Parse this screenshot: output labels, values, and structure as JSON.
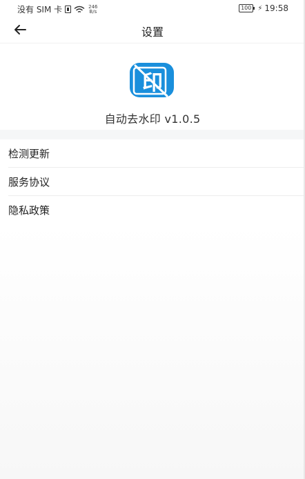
{
  "status_bar": {
    "carrier": "没有 SIM 卡",
    "net_speed_value": "246",
    "net_speed_unit": "B/s",
    "battery": "100",
    "time": "19:58"
  },
  "app_bar": {
    "back_icon": "arrow-left-icon",
    "title": "设置"
  },
  "about": {
    "logo_icon": "watermark-remover-logo-icon",
    "logo_char": "印",
    "brand_color": "#1a8fdc",
    "version_text": "自动去水印 v1.0.5"
  },
  "settings": {
    "items": [
      {
        "label": "检测更新"
      },
      {
        "label": "服务协议"
      },
      {
        "label": "隐私政策"
      }
    ]
  }
}
